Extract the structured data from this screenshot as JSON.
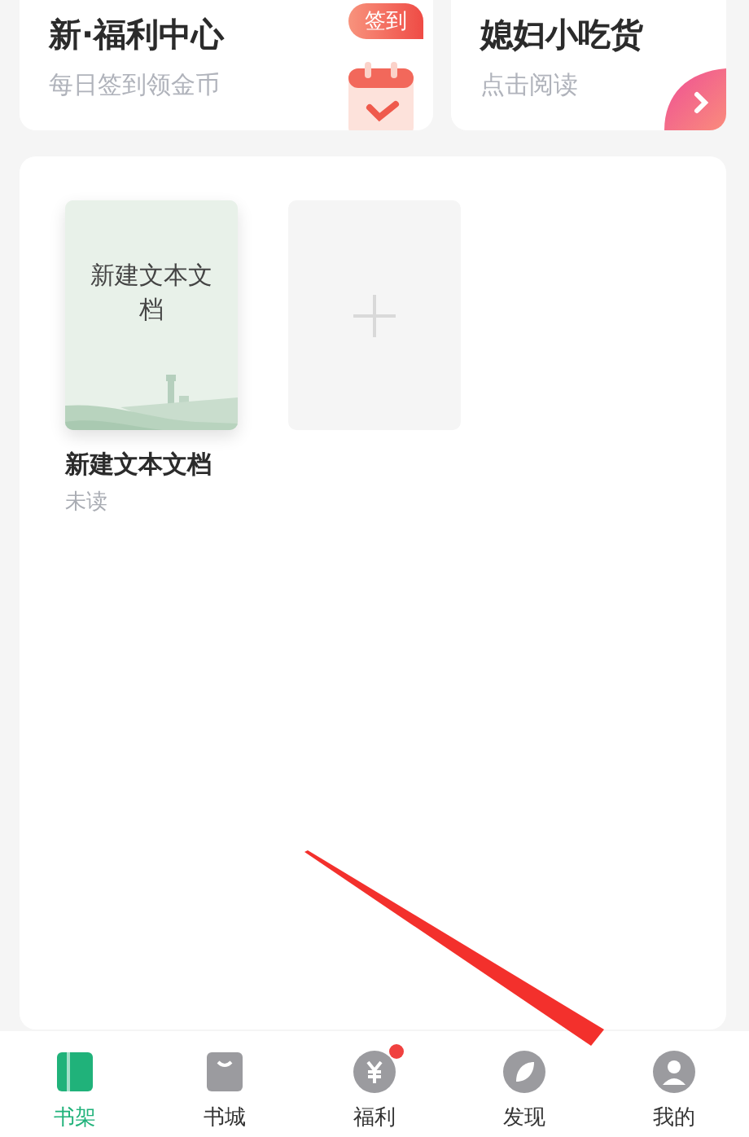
{
  "cards": [
    {
      "kind": "checkin",
      "title": "新·福利中心",
      "subtitle": "每日签到领金币",
      "badge": "签到"
    },
    {
      "kind": "read",
      "title": "媳妇小吃货",
      "subtitle": "点击阅读"
    }
  ],
  "shelf": {
    "books": [
      {
        "cover_title": "新建文本文档",
        "title": "新建文本文档",
        "status": "未读"
      }
    ]
  },
  "tabs": [
    {
      "kind": "shelf",
      "label": "书架",
      "selected": true,
      "dot": false
    },
    {
      "kind": "store",
      "label": "书城",
      "selected": false,
      "dot": false
    },
    {
      "kind": "welfare",
      "label": "福利",
      "selected": false,
      "dot": true
    },
    {
      "kind": "discover",
      "label": "发现",
      "selected": false,
      "dot": false
    },
    {
      "kind": "me",
      "label": "我的",
      "selected": false,
      "dot": false
    }
  ]
}
